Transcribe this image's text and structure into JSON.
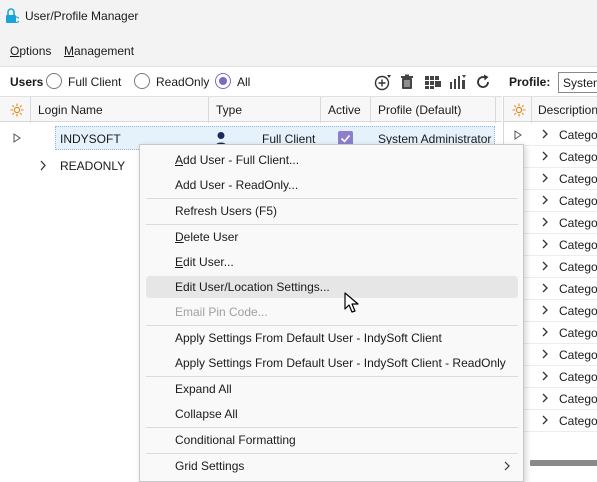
{
  "window": {
    "title": "User/Profile Manager"
  },
  "menubar": {
    "items": [
      {
        "label": "Options"
      },
      {
        "label": "Management"
      }
    ]
  },
  "toolbar": {
    "users_label": "Users",
    "filters": [
      {
        "label": "Full Client",
        "checked": false
      },
      {
        "label": "ReadOnly",
        "checked": false
      },
      {
        "label": "All",
        "checked": true
      }
    ],
    "icons": [
      "add-user-icon",
      "delete-icon",
      "grid-layout-icon",
      "chart-settings-icon",
      "refresh-icon"
    ],
    "profile_label": "Profile:",
    "profile_value": "System"
  },
  "grid": {
    "columns": [
      "Login Name",
      "Type",
      "Active",
      "Profile (Default)"
    ],
    "rows": [
      {
        "login": "INDYSOFT",
        "type": "Full Client",
        "active": true,
        "profile": "System Administrator",
        "selected": true
      },
      {
        "login": "READONLY",
        "type": "",
        "active": false,
        "profile": "",
        "selected": false
      }
    ]
  },
  "right_grid": {
    "column": "Description",
    "rows": [
      "Category",
      "Category",
      "Category",
      "Category",
      "Category",
      "Category",
      "Category",
      "Category",
      "Category",
      "Category",
      "Category",
      "Category",
      "Category",
      "Category"
    ]
  },
  "context_menu": {
    "items": [
      {
        "label": "Add User - Full Client...",
        "ul": "A",
        "rest": "dd User - Full Client...",
        "disabled": false,
        "hover": false
      },
      {
        "label": "Add User - ReadOnly...",
        "ul": "",
        "rest": "Add User - ReadOnly...",
        "disabled": false,
        "hover": false
      },
      {
        "label": "Refresh Users (F5)",
        "ul": "",
        "rest": "Refresh Users (F5)",
        "disabled": false,
        "hover": false
      },
      {
        "label": "Delete User",
        "ul": "D",
        "rest": "elete User",
        "disabled": false,
        "hover": false
      },
      {
        "label": "Edit User...",
        "ul": "E",
        "rest": "dit User...",
        "disabled": false,
        "hover": false
      },
      {
        "label": "Edit User/Location Settings...",
        "ul": "",
        "rest": "Edit User/Location Settings...",
        "disabled": false,
        "hover": true
      },
      {
        "label": "Email Pin Code...",
        "ul": "",
        "rest": "Email Pin Code...",
        "disabled": true,
        "hover": false
      },
      {
        "label": "Apply Settings From Default User - IndySoft Client",
        "ul": "",
        "rest": "Apply Settings From Default User - IndySoft Client",
        "disabled": false,
        "hover": false
      },
      {
        "label": "Apply Settings From Default User - IndySoft Client - ReadOnly",
        "ul": "",
        "rest": "Apply Settings From Default User - IndySoft Client - ReadOnly",
        "disabled": false,
        "hover": false
      },
      {
        "label": "Expand All",
        "ul": "",
        "rest": "Expand All",
        "disabled": false,
        "hover": false
      },
      {
        "label": "Collapse All",
        "ul": "",
        "rest": "Collapse All",
        "disabled": false,
        "hover": false
      },
      {
        "label": "Conditional Formatting",
        "ul": "",
        "rest": "Conditional Formatting",
        "disabled": false,
        "hover": false
      },
      {
        "label": "Grid Settings",
        "ul": "",
        "rest": "Grid Settings",
        "disabled": false,
        "hover": false,
        "submenu": true
      }
    ]
  },
  "colors": {
    "accent": "#7a6bc4",
    "selection": "#e5f1fb",
    "menu_bg": "#f9f9f9",
    "app_icon": "#1aa3d9"
  }
}
